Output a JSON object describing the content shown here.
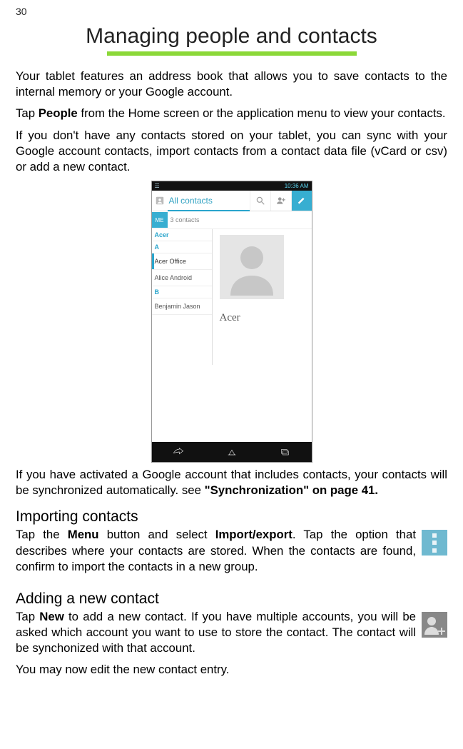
{
  "page_number": "30",
  "title": "Managing people and contacts",
  "para1": "Your tablet features an address book that allows you to save contacts to the internal memory or your Google account.",
  "para2a": "Tap ",
  "para2b": "People",
  "para2c": " from the Home screen or the application menu to view your contacts.",
  "para3": "If you don't have any contacts stored on your tablet, you can sync with your Google account contacts, import contacts from a contact data file (vCard or csv) or add a new contact.",
  "screenshot": {
    "status_time": "10:36 AM",
    "tab_label": "All contacts",
    "me_label": "ME",
    "me_count": "3 contacts",
    "section_acer": "Acer",
    "section_a": "A",
    "section_b": "B",
    "items": {
      "acer_office": "Acer Office",
      "alice": "Alice Android",
      "benjamin": "Benjamin Jason"
    },
    "detail_name": "Acer"
  },
  "para4a": "If you have activated a Google account that includes contacts, your contacts will be synchronized automatically. see ",
  "para4b": "\"Synchronization\" on page 41.",
  "sec_import_title": "Importing contacts",
  "sec_import_a": "Tap the ",
  "sec_import_b": "Menu",
  "sec_import_c": " button and select ",
  "sec_import_d": "Import/export",
  "sec_import_e": ". Tap the option that describes where your contacts are stored. When the contacts are found, confirm to import the contacts in a new group.",
  "sec_add_title": "Adding a new contact",
  "sec_add_a": "Tap ",
  "sec_add_b": "New",
  "sec_add_c": " to add a new contact. If you have multiple accounts, you will be asked which account you want to use to store the contact. The contact will be synchonized with that account.",
  "sec_add_para2": "You may now edit the new contact entry."
}
